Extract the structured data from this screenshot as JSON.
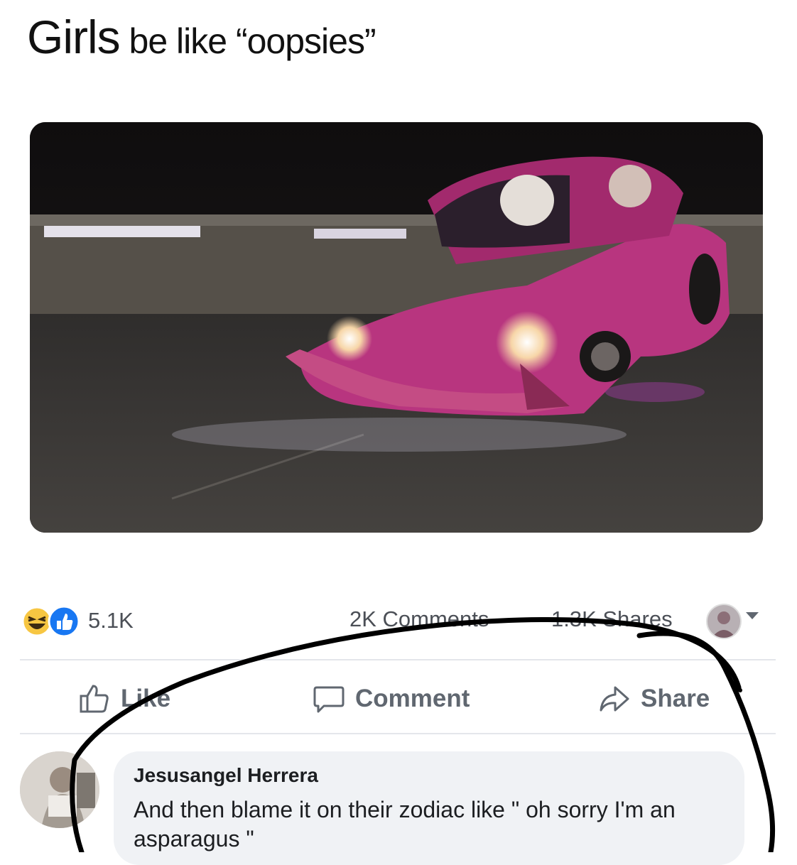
{
  "post": {
    "title_first": "Girls",
    "title_rest": " be like “oopsies”"
  },
  "stats": {
    "reactions": "5.1K",
    "comments": "2K Comments",
    "shares": "1.3K Shares",
    "reaction_icons": [
      "laugh-reaction-icon",
      "like-reaction-icon"
    ]
  },
  "actions": {
    "like": "Like",
    "comment": "Comment",
    "share": "Share"
  },
  "comment": {
    "author": "Jesusangel Herrera",
    "text": "And then blame it on their zodiac like \" oh sorry I'm an asparagus \""
  },
  "colors": {
    "car": "#b8357f",
    "like_blue": "#1877f2",
    "laugh_yellow": "#f7c642",
    "scribble": "#000000"
  }
}
